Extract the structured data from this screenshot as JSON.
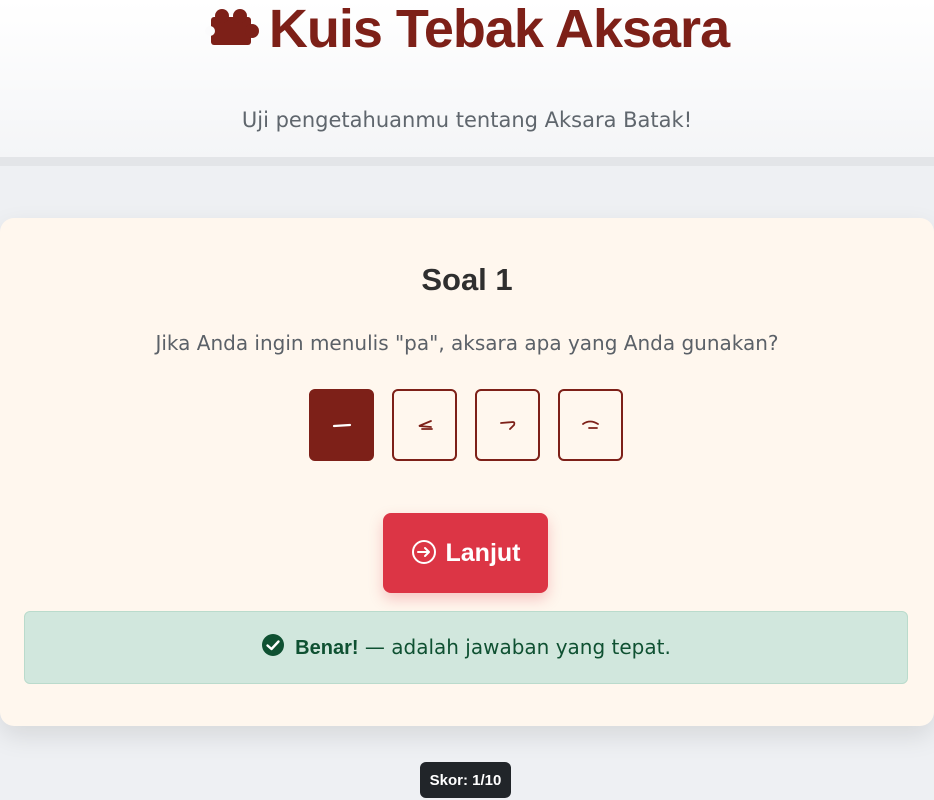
{
  "header": {
    "title": "Kuis Tebak Aksara",
    "title_icon": "puzzle-piece-icon",
    "subtitle": "Uji pengetahuanmu tentang Aksara Batak!"
  },
  "quiz": {
    "question_title": "Soal 1",
    "question_text": "Jika Anda ingin menulis \"pa\", aksara apa yang Anda gunakan?",
    "options": [
      {
        "glyph": "–",
        "selected": true
      },
      {
        "glyph": "⪦",
        "selected": false
      },
      {
        "glyph": "⌐",
        "selected": false
      },
      {
        "glyph": "⌒",
        "selected": false
      }
    ],
    "next_button": {
      "label": "Lanjut",
      "icon": "arrow-circle-right-icon"
    },
    "feedback": {
      "icon": "check-circle-icon",
      "strong": "Benar!",
      "rest": " — adalah jawaban yang tepat."
    }
  },
  "score": {
    "label": "Skor: 1/10"
  },
  "colors": {
    "brand": "#7d2018",
    "danger": "#dc3545",
    "success_bg": "#d1e7dd",
    "success_text": "#0f5132",
    "card_bg": "#fff7ee",
    "dark": "#212529"
  }
}
